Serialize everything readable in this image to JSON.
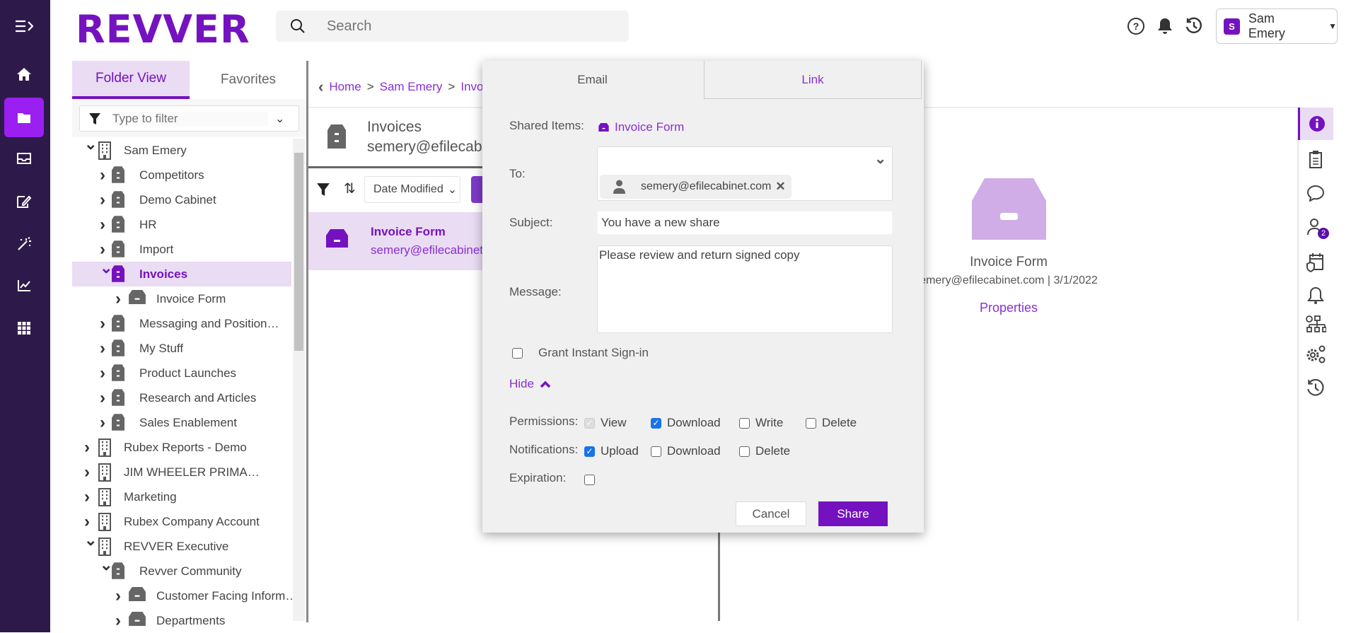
{
  "app": {
    "logo": "REVVER"
  },
  "header": {
    "search_placeholder": "Search",
    "user_initial": "S",
    "user_name": "Sam Emery"
  },
  "left_panel": {
    "tabs": [
      {
        "label": "Folder View"
      },
      {
        "label": "Favorites"
      }
    ],
    "filter_placeholder": "Type to filter",
    "tree": [
      {
        "label": "Sam Emery",
        "level": 0,
        "type": "building",
        "expanded": true
      },
      {
        "label": "Competitors",
        "level": 1,
        "type": "cabinet"
      },
      {
        "label": "Demo Cabinet",
        "level": 1,
        "type": "cabinet"
      },
      {
        "label": "HR",
        "level": 1,
        "type": "cabinet"
      },
      {
        "label": "Import",
        "level": 1,
        "type": "cabinet"
      },
      {
        "label": "Invoices",
        "level": 1,
        "type": "cabinet",
        "expanded": true,
        "selected": true
      },
      {
        "label": "Invoice Form",
        "level": 2,
        "type": "drawer"
      },
      {
        "label": "Messaging and Positioning",
        "level": 1,
        "type": "cabinet"
      },
      {
        "label": "My Stuff",
        "level": 1,
        "type": "cabinet"
      },
      {
        "label": "Product Launches",
        "level": 1,
        "type": "cabinet"
      },
      {
        "label": "Research and Articles",
        "level": 1,
        "type": "cabinet"
      },
      {
        "label": "Sales Enablement",
        "level": 1,
        "type": "cabinet"
      },
      {
        "label": "Rubex Reports - Demo",
        "level": 0,
        "type": "building"
      },
      {
        "label": "JIM WHEELER PRIMARY Account",
        "level": 0,
        "type": "building"
      },
      {
        "label": "Marketing",
        "level": 0,
        "type": "building"
      },
      {
        "label": "Rubex Company Account",
        "level": 0,
        "type": "building"
      },
      {
        "label": "REVVER Executive",
        "level": 0,
        "type": "building",
        "expanded": true
      },
      {
        "label": "Revver Community",
        "level": 1,
        "type": "cabinet",
        "expanded": true
      },
      {
        "label": "Customer Facing Inform…",
        "level": 2,
        "type": "drawer"
      },
      {
        "label": "Departments",
        "level": 2,
        "type": "drawer"
      }
    ]
  },
  "middle": {
    "breadcrumb": [
      "Home",
      "Sam Emery",
      "Invoi"
    ],
    "folder_title": "Invoices",
    "folder_owner": "semery@efilecabinet",
    "sort_label": "Date Modified",
    "items": [
      {
        "name": "Invoice Form",
        "owner": "semery@efilecabinet.c"
      }
    ]
  },
  "details": {
    "name": "Invoice Form",
    "meta": "emery@efilecabinet.com | 3/1/2022",
    "properties_link": "Properties",
    "users_badge": "2"
  },
  "dialog": {
    "tabs": [
      {
        "label": "Email"
      },
      {
        "label": "Link"
      }
    ],
    "shared_items_label": "Shared Items:",
    "shared_item": "Invoice Form",
    "to_label": "To:",
    "recipient": "semery@efilecabinet.com",
    "subject_label": "Subject:",
    "subject": "You have a new share",
    "message_label": "Message:",
    "message": "Please review and return signed copy",
    "grant_label": "Grant Instant Sign-in",
    "hide_label": "Hide",
    "permissions_label": "Permissions:",
    "permissions": [
      {
        "label": "View",
        "checked": true,
        "disabled": true
      },
      {
        "label": "Download",
        "checked": true
      },
      {
        "label": "Write",
        "checked": false
      },
      {
        "label": "Delete",
        "checked": false
      }
    ],
    "notifications_label": "Notifications:",
    "notifications": [
      {
        "label": "Upload",
        "checked": true
      },
      {
        "label": "Download",
        "checked": false
      },
      {
        "label": "Delete",
        "checked": false
      }
    ],
    "expiration_label": "Expiration:",
    "cancel_label": "Cancel",
    "share_label": "Share"
  },
  "colors": {
    "brand": "#7512c0",
    "nav_bg": "#2e1a4a",
    "selected_bg": "#e9dcf3"
  }
}
